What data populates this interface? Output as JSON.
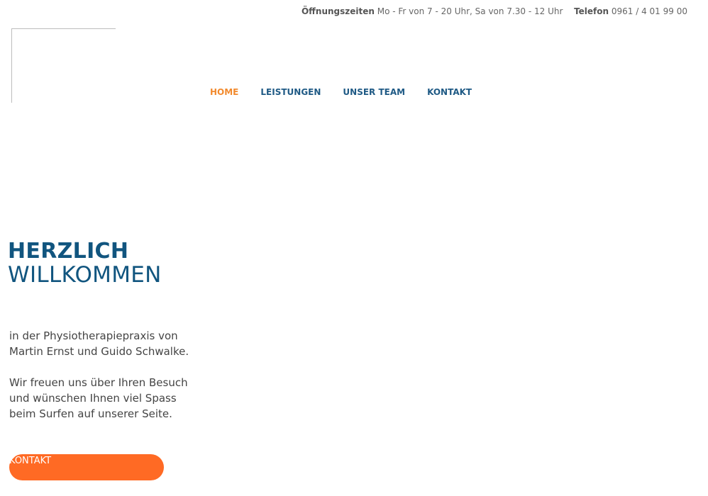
{
  "topbar": {
    "hours_label": "Öffnungszeiten",
    "hours_value": "Mo - Fr von 7 - 20 Uhr, Sa von 7.30 - 12 Uhr",
    "phone_label": "Telefon",
    "phone_value": "0961 / 4 01 99 00"
  },
  "nav": {
    "items": [
      {
        "label": "HOME"
      },
      {
        "label": "LEISTUNGEN"
      },
      {
        "label": "UNSER TEAM"
      },
      {
        "label": "KONTAKT"
      }
    ]
  },
  "hero": {
    "title_line1": "HERZLICH",
    "title_line2": "WILLKOMMEN",
    "paragraph1": "in der Physiotherapiepraxis von Martin Ernst und Guido Schwalke.",
    "paragraph2": "Wir freuen uns über Ihren Besuch und wünschen Ihnen viel Spass beim Surfen auf unserer Seite.",
    "cta_label": "KONTAKT"
  },
  "colors": {
    "accent_orange": "#ff6a24",
    "nav_active": "#f28a2e",
    "brand_blue": "#11557f"
  }
}
